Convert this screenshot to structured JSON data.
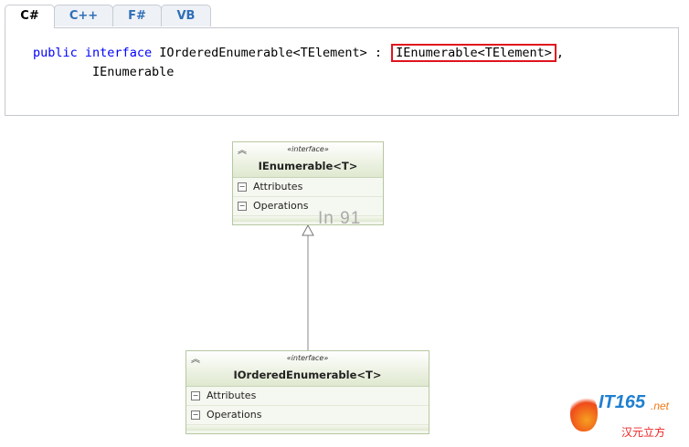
{
  "tabs": [
    {
      "label": "C#",
      "active": true
    },
    {
      "label": "C++",
      "active": false
    },
    {
      "label": "F#",
      "active": false
    },
    {
      "label": "VB",
      "active": false
    }
  ],
  "code": {
    "kw1": "public",
    "kw2": "interface",
    "decl": " IOrderedEnumerable<TElement> : ",
    "highlighted": "IEnumerable<TElement>",
    "comma": ",",
    "line2": "        IEnumerable"
  },
  "diagram": {
    "top_class": {
      "stereotype": "«interface»",
      "name": "IEnumerable<T>",
      "compartments": [
        "Attributes",
        "Operations"
      ]
    },
    "bottom_class": {
      "stereotype": "«interface»",
      "name": "IOrderedEnumerable<T>",
      "compartments": [
        "Attributes",
        "Operations"
      ]
    }
  },
  "watermark": "In 91",
  "logo": {
    "it": "IT165",
    "net": ".net",
    "cn": "汉元立方"
  },
  "colors": {
    "highlight": "#e0141e",
    "keyword": "#0000ff",
    "tab_link": "#2f6fb8"
  }
}
